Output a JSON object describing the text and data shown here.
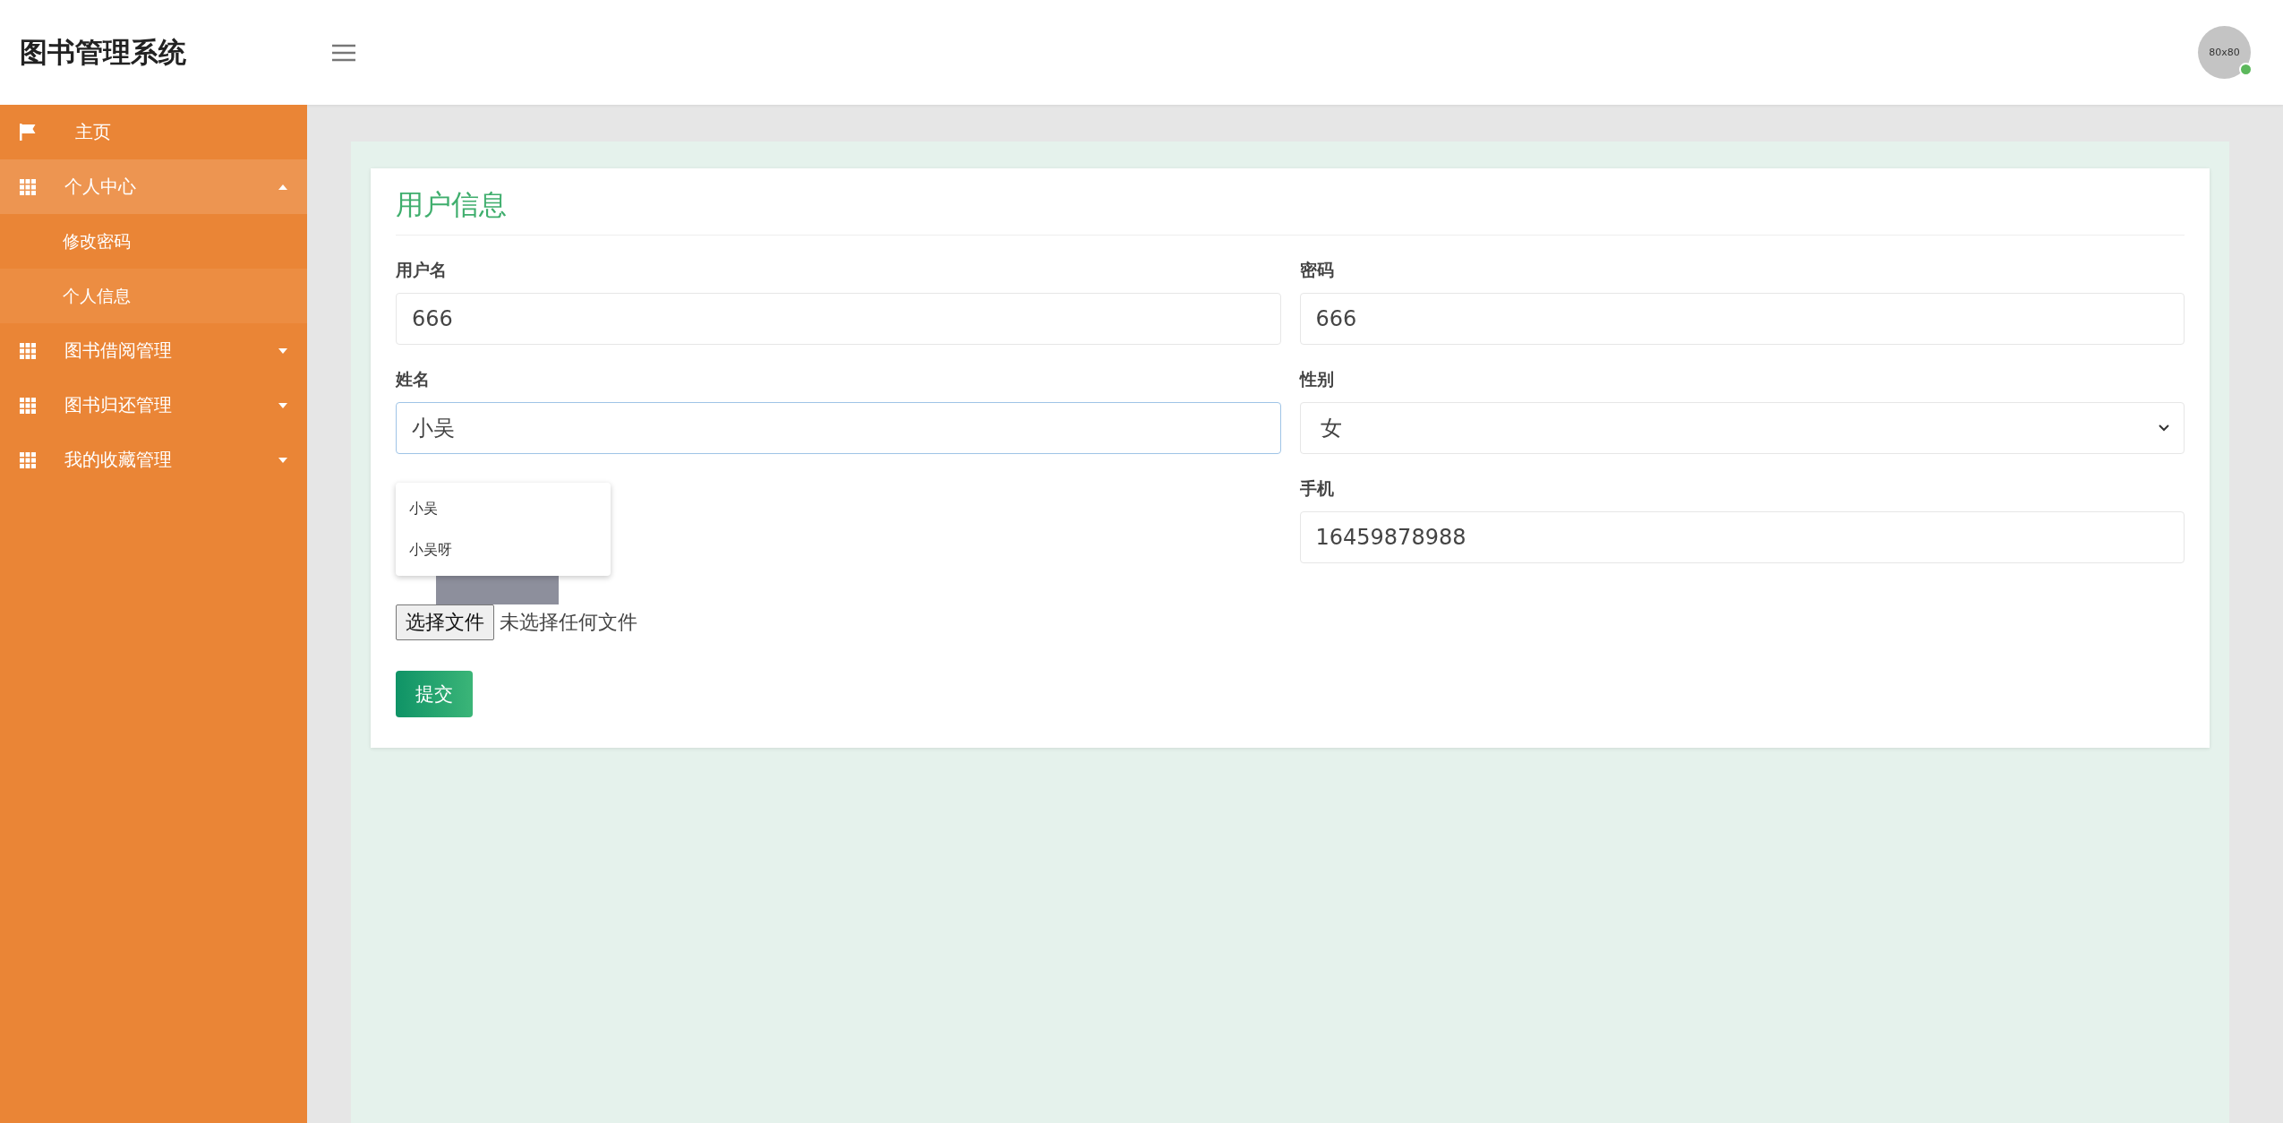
{
  "header": {
    "title": "图书管理系统",
    "avatar": "80x80",
    "online": true
  },
  "sidebar": {
    "items": [
      {
        "label": "主页",
        "kind": "link"
      },
      {
        "label": "个人中心",
        "kind": "group",
        "expanded": true,
        "children": [
          {
            "label": "修改密码",
            "selected": false
          },
          {
            "label": "个人信息",
            "selected": true
          }
        ]
      },
      {
        "label": "图书借阅管理",
        "kind": "group",
        "expanded": false
      },
      {
        "label": "图书归还管理",
        "kind": "group",
        "expanded": false
      },
      {
        "label": "我的收藏管理",
        "kind": "group",
        "expanded": false
      }
    ]
  },
  "form": {
    "title": "用户信息",
    "fields": [
      {
        "kind": "text",
        "label": "用户名",
        "value": "666",
        "focused": false
      },
      {
        "kind": "text",
        "label": "密码",
        "value": "666",
        "focused": false
      },
      {
        "kind": "text",
        "label": "姓名",
        "value": "小吴",
        "focused": true,
        "suggestions": [
          "小吴",
          "小吴呀"
        ]
      },
      {
        "kind": "select",
        "label": "性别",
        "value": "女"
      },
      {
        "kind": "image",
        "file_button": "选择文件",
        "file_status": "未选择任何文件"
      },
      {
        "kind": "text",
        "label": "手机",
        "value": "16459878988",
        "focused": false
      }
    ],
    "submit": "提交"
  }
}
